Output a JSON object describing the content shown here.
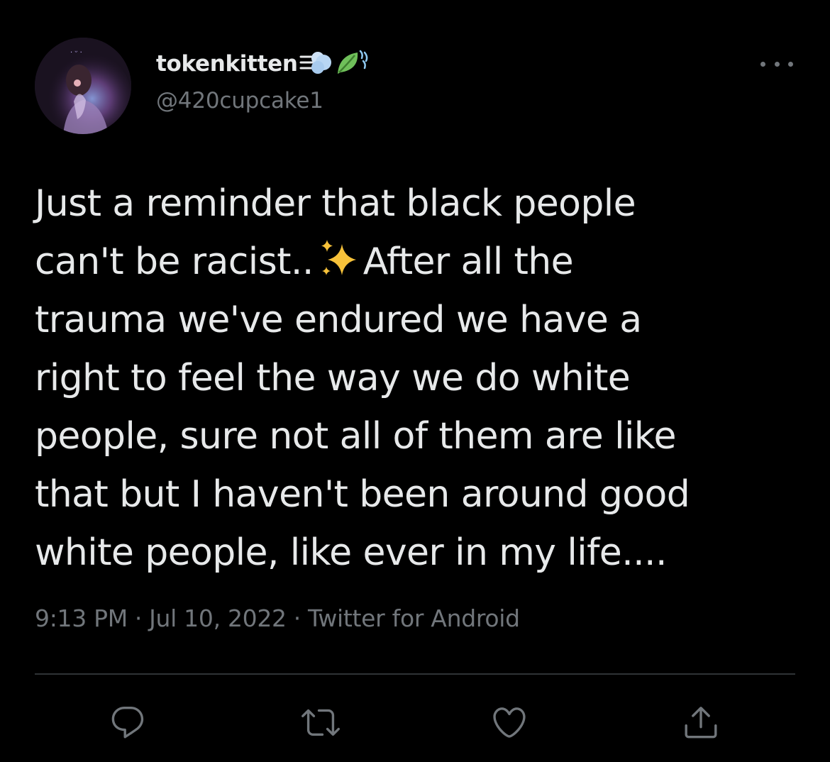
{
  "tweet": {
    "author": {
      "display_name": "tokenkitten",
      "name_emojis": [
        "dash-emoji",
        "leaf-emoji"
      ],
      "handle": "@420cupcake1",
      "avatar": "avatar"
    },
    "more_icon": "more-horizontal-icon",
    "text_lines": [
      "Just a reminder that black people",
      "can't be racist..",
      "After all the",
      "trauma we've endured we have a",
      "right to feel the way we do white",
      "people, sure not all of them are like",
      "that but I haven't been around good",
      "white people, like ever in my life...."
    ],
    "inline_emoji": "sparkles-emoji",
    "meta": {
      "time": "9:13 PM",
      "separator": "·",
      "date": "Jul 10, 2022",
      "source": "Twitter for Android"
    },
    "actions": [
      {
        "name": "reply",
        "icon": "reply-icon"
      },
      {
        "name": "retweet",
        "icon": "retweet-icon"
      },
      {
        "name": "like",
        "icon": "heart-icon"
      },
      {
        "name": "share",
        "icon": "share-icon"
      }
    ]
  },
  "colors": {
    "background": "#000000",
    "primary_text": "#e7e9ea",
    "secondary_text": "#71767b",
    "divider": "#2f3336"
  }
}
